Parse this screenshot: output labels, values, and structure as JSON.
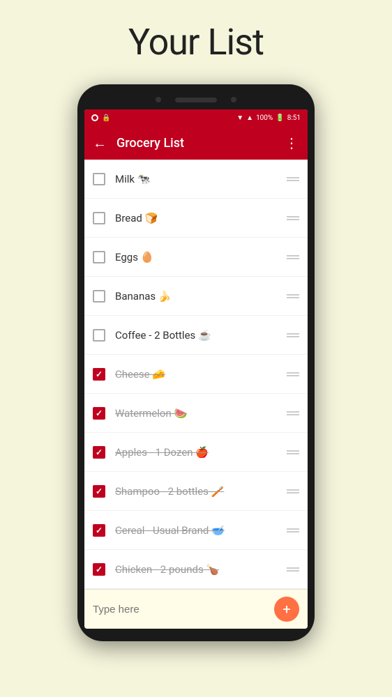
{
  "page": {
    "title": "Your List"
  },
  "status_bar": {
    "battery": "100%",
    "time": "8:51"
  },
  "app_bar": {
    "title": "Grocery List",
    "back_label": "←",
    "menu_label": "⋮"
  },
  "list_items": [
    {
      "id": 1,
      "text": "Milk 🐄",
      "checked": false
    },
    {
      "id": 2,
      "text": "Bread 🍞",
      "checked": false
    },
    {
      "id": 3,
      "text": "Eggs 🥚",
      "checked": false
    },
    {
      "id": 4,
      "text": "Bananas 🍌",
      "checked": false
    },
    {
      "id": 5,
      "text": "Coffee - 2 Bottles ☕",
      "checked": false
    },
    {
      "id": 6,
      "text": "Cheese 🧀",
      "checked": true
    },
    {
      "id": 7,
      "text": "Watermelon 🍉",
      "checked": true
    },
    {
      "id": 8,
      "text": "Apples - 1 Dozen 🍎",
      "checked": true
    },
    {
      "id": 9,
      "text": "Shampoo - 2 bottles 🪥",
      "checked": true
    },
    {
      "id": 10,
      "text": "Cereal - Usual Brand 🥣",
      "checked": true
    },
    {
      "id": 11,
      "text": "Chicken - 2 pounds 🍗",
      "checked": true
    }
  ],
  "input_bar": {
    "placeholder": "Type here",
    "add_label": "+"
  }
}
